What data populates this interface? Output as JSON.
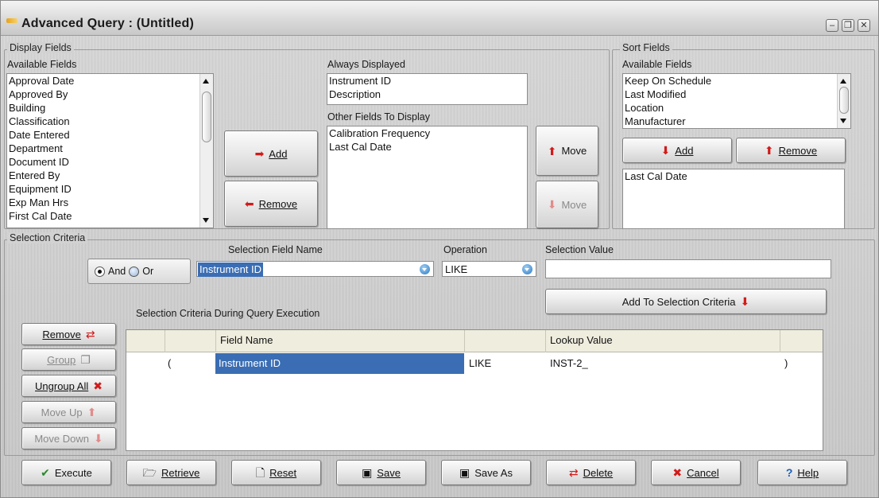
{
  "window": {
    "title": "Advanced Query : (Untitled)",
    "controls": [
      "minimize",
      "restore",
      "close"
    ]
  },
  "display_fields": {
    "legend": "Display Fields",
    "available_label": "Available Fields",
    "available_items": [
      "Approval Date",
      "Approved By",
      "Building",
      "Classification",
      "Date Entered",
      "Department",
      "Document ID",
      "Entered By",
      "Equipment ID",
      "Exp Man Hrs",
      "First Cal Date"
    ],
    "add_label": "Add",
    "remove_label": "Remove",
    "always_label": "Always Displayed",
    "always_items": [
      "Instrument ID",
      "Description"
    ],
    "other_label": "Other Fields To Display",
    "other_items": [
      "Calibration Frequency",
      "Last Cal Date"
    ],
    "move_up_label": "Move",
    "move_down_label": "Move"
  },
  "sort_fields": {
    "legend": "Sort Fields",
    "available_label": "Available Fields",
    "available_items": [
      "Keep On Schedule",
      "Last Modified",
      "Location",
      "Manufacturer"
    ],
    "add_label": "Add",
    "remove_label": "Remove",
    "selected_items": [
      "Last Cal Date"
    ]
  },
  "selection": {
    "legend": "Selection Criteria",
    "and_label": "And",
    "or_label": "Or",
    "field_name_label": "Selection Field Name",
    "field_name_value": "Instrument ID",
    "operation_label": "Operation",
    "operation_value": "LIKE",
    "value_label": "Selection Value",
    "value_value": "",
    "add_to_label": "Add To Selection Criteria",
    "during_label": "Selection Criteria During Query Execution",
    "grid_headers": [
      "",
      "",
      "Field Name",
      "",
      "Lookup Value",
      ""
    ],
    "rows": [
      {
        "open": "(",
        "field": "Instrument ID",
        "op": "LIKE",
        "value": "INST-2_",
        "close": ")"
      }
    ]
  },
  "side_buttons": {
    "remove": "Remove",
    "group": "Group",
    "ungroup_all": "Ungroup All",
    "move_up": "Move Up",
    "move_down": "Move Down"
  },
  "bottom_buttons": {
    "execute": "Execute",
    "retrieve": "Retrieve",
    "reset": "Reset",
    "save": "Save",
    "save_as": "Save As",
    "delete": "Delete",
    "cancel": "Cancel",
    "help": "Help"
  },
  "colors": {
    "selection_highlight": "#3a6db3",
    "arrow_red": "#d21a1a",
    "grid_header": "#efedde"
  }
}
